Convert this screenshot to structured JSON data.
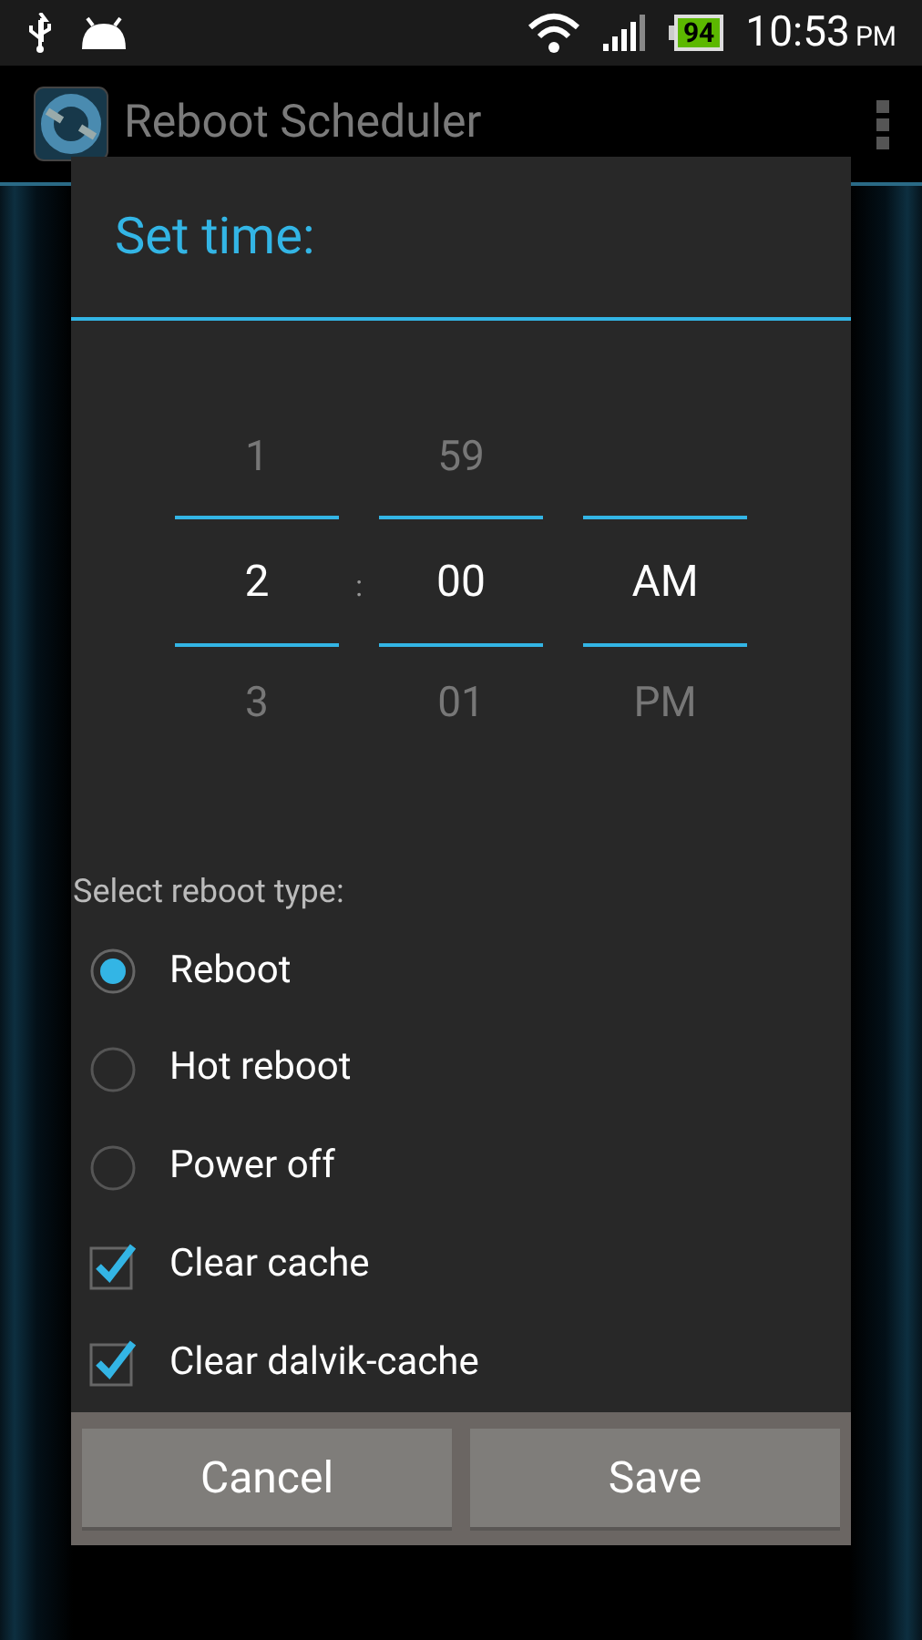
{
  "status_bar": {
    "time": "10:53",
    "ampm": "PM",
    "battery": "94"
  },
  "action_bar": {
    "title": "Reboot Scheduler"
  },
  "dialog": {
    "title": "Set time:",
    "picker": {
      "separator": ":",
      "columns": [
        {
          "above": "1",
          "value": "2",
          "below": "3"
        },
        {
          "above": "59",
          "value": "00",
          "below": "01"
        },
        {
          "value": "AM",
          "below": "PM"
        }
      ]
    },
    "options_label": "Select reboot type:",
    "options": [
      {
        "kind": "radio",
        "label": "Reboot",
        "selected": true
      },
      {
        "kind": "radio",
        "label": "Hot reboot",
        "selected": false
      },
      {
        "kind": "radio",
        "label": "Power off",
        "selected": false
      },
      {
        "kind": "checkbox",
        "label": "Clear cache",
        "checked": true
      },
      {
        "kind": "checkbox",
        "label": "Clear dalvik-cache",
        "checked": true
      }
    ],
    "buttons": [
      "Cancel",
      "Save"
    ]
  }
}
